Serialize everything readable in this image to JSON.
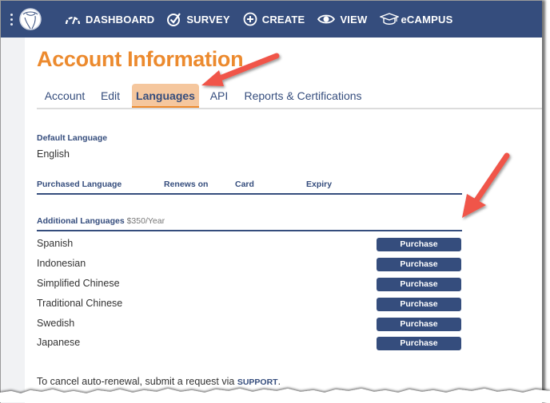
{
  "topbar": {
    "nav": [
      {
        "label": "DASHBOARD",
        "icon": "gauge-icon"
      },
      {
        "label": "SURVEY",
        "icon": "check-circle-icon"
      },
      {
        "label": "CREATE",
        "icon": "plus-circle-icon"
      },
      {
        "label": "VIEW",
        "icon": "eye-icon"
      },
      {
        "label": "eCAMPUS",
        "icon": "graduation-cap-icon"
      }
    ]
  },
  "page": {
    "title": "Account Information",
    "tabs": [
      {
        "label": "Account",
        "active": false
      },
      {
        "label": "Edit",
        "active": false
      },
      {
        "label": "Languages",
        "active": true
      },
      {
        "label": "API",
        "active": false
      },
      {
        "label": "Reports & Certifications",
        "active": false
      }
    ]
  },
  "default_language": {
    "label": "Default Language",
    "value": "English"
  },
  "purchased_table": {
    "columns": [
      "Purchased Language",
      "Renews on",
      "Card",
      "Expiry"
    ]
  },
  "additional": {
    "label": "Additional Languages",
    "price": "$350/Year",
    "button_label": "Purchase",
    "languages": [
      "Spanish",
      "Indonesian",
      "Simplified Chinese",
      "Traditional Chinese",
      "Swedish",
      "Japanese"
    ]
  },
  "footer": {
    "text": "To cancel auto-renewal, submit a request via ",
    "link": "SUPPORT",
    "end": "."
  },
  "colors": {
    "navy": "#354d7d",
    "orange": "#ec8a2e",
    "tab_active_bg": "#f5c79e",
    "annotation_arrow": "#f0544a"
  }
}
